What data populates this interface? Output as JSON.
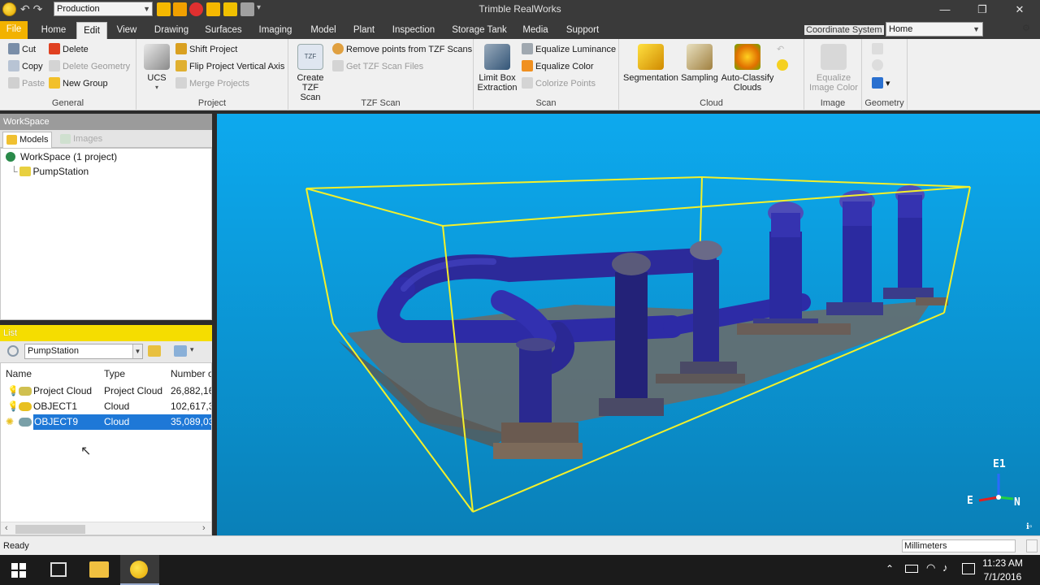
{
  "window": {
    "title": "Trimble RealWorks",
    "project_select": "Production"
  },
  "tabs": [
    {
      "label": "File"
    },
    {
      "label": "Home"
    },
    {
      "label": "Edit"
    },
    {
      "label": "View"
    },
    {
      "label": "Drawing"
    },
    {
      "label": "Surfaces"
    },
    {
      "label": "Imaging"
    },
    {
      "label": "Model"
    },
    {
      "label": "Plant"
    },
    {
      "label": "Inspection"
    },
    {
      "label": "Storage Tank"
    },
    {
      "label": "Media"
    },
    {
      "label": "Support"
    }
  ],
  "active_tab": "Edit",
  "coordinate_system": {
    "label": "Coordinate System",
    "value": "Home"
  },
  "ribbon": {
    "general": {
      "label": "General",
      "cut": "Cut",
      "copy": "Copy",
      "paste": "Paste",
      "delete": "Delete",
      "delete_geometry": "Delete Geometry",
      "new_group": "New Group"
    },
    "project": {
      "label": "Project",
      "ucs": "UCS",
      "shift_project": "Shift Project",
      "flip_axis": "Flip Project Vertical Axis",
      "merge_projects": "Merge Projects"
    },
    "tzf": {
      "label": "TZF Scan",
      "create_line1": "Create",
      "create_line2": "TZF Scan",
      "remove_points": "Remove points from TZF Scans",
      "get_files": "Get TZF Scan Files",
      "icon_text": "TZF"
    },
    "scan": {
      "label": "Scan",
      "limit_line1": "Limit Box",
      "limit_line2": "Extraction",
      "equalize_luminance": "Equalize Luminance",
      "equalize_color": "Equalize Color",
      "colorize_points": "Colorize Points"
    },
    "cloud": {
      "label": "Cloud",
      "segmentation": "Segmentation",
      "sampling": "Sampling",
      "auto_line1": "Auto-Classify",
      "auto_line2": "Clouds"
    },
    "image": {
      "label": "Image",
      "eq_line1": "Equalize",
      "eq_line2": "Image Color"
    },
    "geometry": {
      "label": "Geometry"
    }
  },
  "workspace": {
    "header": "WorkSpace",
    "tab_models": "Models",
    "tab_images": "Images",
    "root": "WorkSpace  (1 project)",
    "project": "PumpStation"
  },
  "list": {
    "header": "List",
    "filter": "PumpStation",
    "columns": [
      "Name",
      "Type",
      "Number o"
    ],
    "rows": [
      {
        "name": "Project Cloud",
        "type": "Project Cloud",
        "number": "26,882,16"
      },
      {
        "name": "OBJECT1",
        "type": "Cloud",
        "number": "102,617,3"
      },
      {
        "name": "OBJECT9",
        "type": "Cloud",
        "number": "35,089,03"
      }
    ],
    "selected_row": 2
  },
  "viewport": {
    "axis_up": "E1",
    "axis_left": "E",
    "axis_right": "N",
    "box_color": "#f4f02a",
    "bg_color": "#0da9ee"
  },
  "status": {
    "text": "Ready",
    "units": "Millimeters"
  },
  "taskbar": {
    "time": "11:23 AM",
    "date": "7/1/2016"
  }
}
